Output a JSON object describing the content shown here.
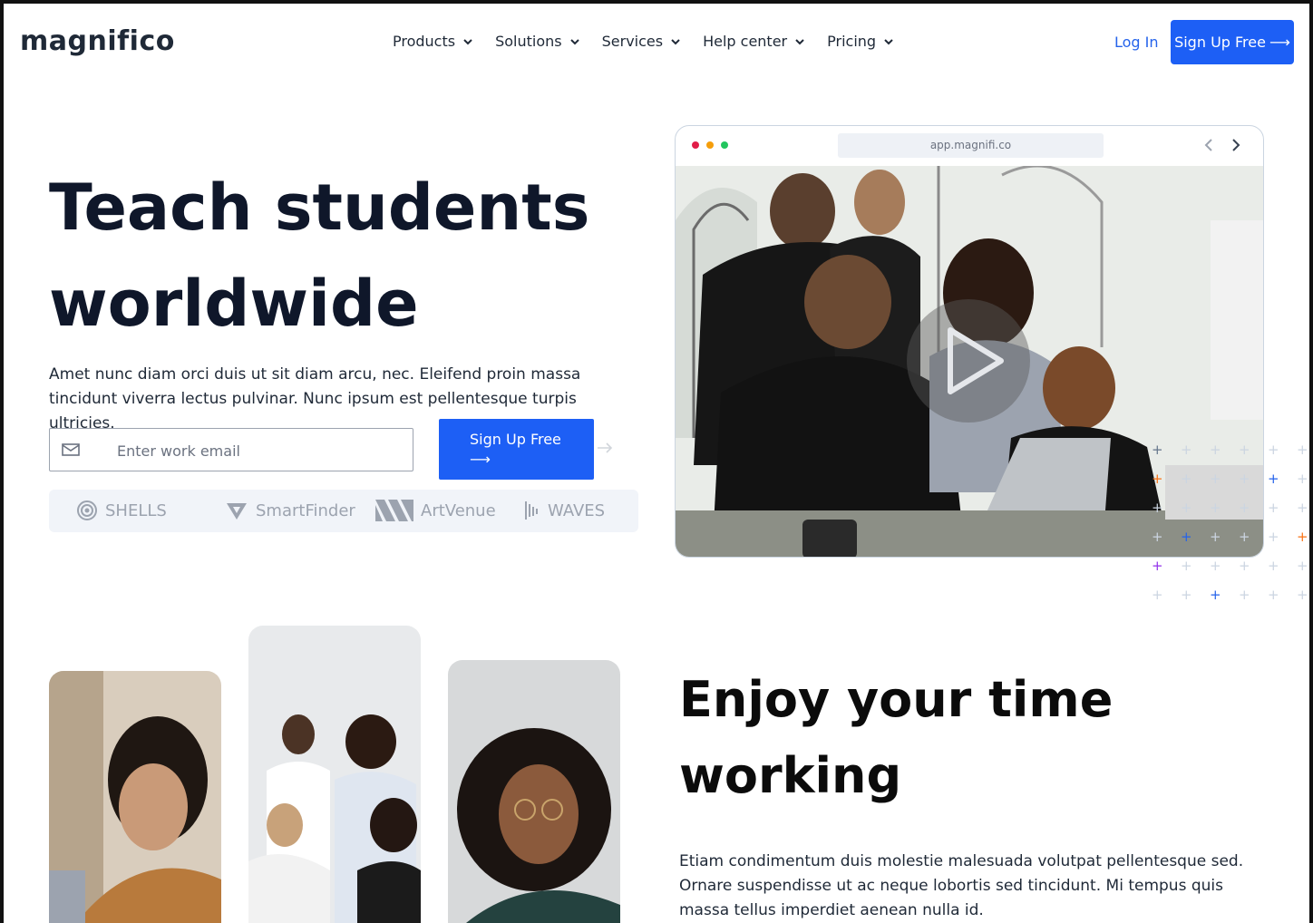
{
  "brand": {
    "logo_text": "magnifico"
  },
  "nav": {
    "items": [
      {
        "label": "Products"
      },
      {
        "label": "Solutions"
      },
      {
        "label": "Services"
      },
      {
        "label": "Help center"
      },
      {
        "label": "Pricing"
      }
    ],
    "login_label": "Log In",
    "signup_label": "Sign Up Free",
    "signup_arrow": "⟶"
  },
  "hero": {
    "title": "Teach students worldwide",
    "subtitle": "Amet nunc diam orci duis ut sit diam arcu, nec. Eleifend proin massa tincidunt viverra lectus pulvinar. Nunc ipsum est pellentesque turpis ultricies.",
    "email_placeholder": "Enter work email",
    "cta_label": "Sign Up Free",
    "cta_arrow": "⟶",
    "brands": [
      {
        "name": "SHELLS",
        "icon": "shells-logo-icon"
      },
      {
        "name": "SmartFinder",
        "icon": "smartfinder-logo-icon"
      },
      {
        "name": "ArtVenue",
        "icon": "artvenue-logo-icon"
      },
      {
        "name": "WAVES",
        "icon": "waves-logo-icon"
      }
    ]
  },
  "browser": {
    "url": "app.magnifi.co",
    "dots": [
      "#e11d48",
      "#f59e0b",
      "#22c55e"
    ]
  },
  "section2": {
    "title": "Enjoy your time working",
    "text": "Etiam condimentum duis molestie malesuada volutpat pellentesque sed. Ornare suspendisse ut ac neque lobortis sed tincidunt. Mi tempus quis massa tellus imperdiet aenean nulla id."
  },
  "colors": {
    "primary": "#1d5ff5",
    "link": "#2563eb",
    "heading": "#0f172a",
    "logos_bg": "#f1f4f9"
  }
}
